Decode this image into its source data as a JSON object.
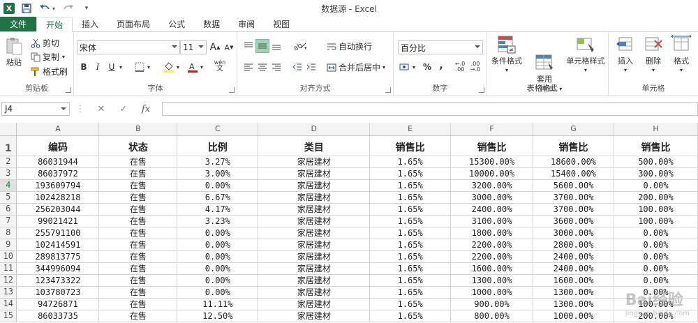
{
  "app": {
    "title": "数据源 - Excel",
    "logo": "X"
  },
  "quick_access": [
    "save-icon",
    "undo-icon",
    "redo-icon",
    "customize-icon"
  ],
  "tabs": [
    {
      "label": "文件"
    },
    {
      "label": "开始"
    },
    {
      "label": "插入"
    },
    {
      "label": "页面布局"
    },
    {
      "label": "公式"
    },
    {
      "label": "数据"
    },
    {
      "label": "审阅"
    },
    {
      "label": "视图"
    }
  ],
  "ribbon": {
    "clipboard": {
      "paste": "粘贴",
      "cut": "剪切",
      "copy": "复制",
      "format_painter": "格式刷",
      "label": "剪贴板"
    },
    "font": {
      "name": "宋体",
      "size": "11",
      "grow": "A",
      "shrink": "A",
      "bold": "B",
      "italic": "I",
      "underline": "U",
      "wen": "wén",
      "label": "字体"
    },
    "alignment": {
      "wrap": "自动换行",
      "merge": "合并后居中",
      "label": "对齐方式"
    },
    "number": {
      "format": "百分比",
      "percent": "%",
      "comma": ",",
      "label": "数字"
    },
    "styles": {
      "conditional": "条件格式",
      "table": "套用\n表格格式",
      "cell": "单元格样式",
      "label": "样式"
    },
    "cells": {
      "insert": "插入",
      "delete": "删除",
      "format": "格式",
      "label": "单元格"
    }
  },
  "formula_bar": {
    "name_box": "J4",
    "fx": "fx",
    "value": ""
  },
  "sheet": {
    "columns": [
      "A",
      "B",
      "C",
      "D",
      "E",
      "F",
      "G",
      "H"
    ],
    "selected_row": "4",
    "headers": [
      "编码",
      "状态",
      "比例",
      "类目",
      "销售比",
      "销售比",
      "销售比",
      "销售比"
    ],
    "rows": [
      {
        "num": "2",
        "cells": [
          "86031944",
          "在售",
          "3.27%",
          "家居建材",
          "1.65%",
          "15300.00%",
          "18600.00%",
          "500.00%"
        ]
      },
      {
        "num": "3",
        "cells": [
          "86037972",
          "在售",
          "3.00%",
          "家居建材",
          "1.65%",
          "10000.00%",
          "15400.00%",
          "300.00%"
        ]
      },
      {
        "num": "4",
        "cells": [
          "193609794",
          "在售",
          "0.00%",
          "家居建材",
          "1.65%",
          "3200.00%",
          "5600.00%",
          "0.00%"
        ]
      },
      {
        "num": "5",
        "cells": [
          "102428218",
          "在售",
          "6.67%",
          "家居建材",
          "1.65%",
          "3000.00%",
          "3700.00%",
          "200.00%"
        ]
      },
      {
        "num": "6",
        "cells": [
          "256203044",
          "在售",
          "4.17%",
          "家居建材",
          "1.65%",
          "2400.00%",
          "3700.00%",
          "100.00%"
        ]
      },
      {
        "num": "7",
        "cells": [
          "99021421",
          "在售",
          "3.23%",
          "家居建材",
          "1.65%",
          "3100.00%",
          "3600.00%",
          "100.00%"
        ]
      },
      {
        "num": "8",
        "cells": [
          "255791100",
          "在售",
          "0.00%",
          "家居建材",
          "1.65%",
          "1800.00%",
          "3000.00%",
          "0.00%"
        ]
      },
      {
        "num": "9",
        "cells": [
          "102414591",
          "在售",
          "0.00%",
          "家居建材",
          "1.65%",
          "2200.00%",
          "2800.00%",
          "0.00%"
        ]
      },
      {
        "num": "10",
        "cells": [
          "289813775",
          "在售",
          "0.00%",
          "家居建材",
          "1.65%",
          "2200.00%",
          "2400.00%",
          "0.00%"
        ]
      },
      {
        "num": "11",
        "cells": [
          "344996094",
          "在售",
          "0.00%",
          "家居建材",
          "1.65%",
          "1600.00%",
          "2400.00%",
          "0.00%"
        ]
      },
      {
        "num": "12",
        "cells": [
          "123473322",
          "在售",
          "0.00%",
          "家居建材",
          "1.65%",
          "1300.00%",
          "1600.00%",
          "0.00%"
        ]
      },
      {
        "num": "13",
        "cells": [
          "103780723",
          "在售",
          "0.00%",
          "家居建材",
          "1.65%",
          "1000.00%",
          "1300.00%",
          "0.00%"
        ]
      },
      {
        "num": "14",
        "cells": [
          "94726871",
          "在售",
          "11.11%",
          "家居建材",
          "1.65%",
          "900.00%",
          "1300.00%",
          "100.00%"
        ]
      },
      {
        "num": "15",
        "cells": [
          "86033735",
          "在售",
          "12.50%",
          "家居建材",
          "1.65%",
          "800.00%",
          "1000.00%",
          "200.00%"
        ]
      }
    ]
  },
  "watermark": {
    "main": "Bai经验",
    "sub": "jingyan.baidu.com"
  },
  "colors": {
    "excel_green": "#217346",
    "selected_fill": "#9fd5b7"
  }
}
